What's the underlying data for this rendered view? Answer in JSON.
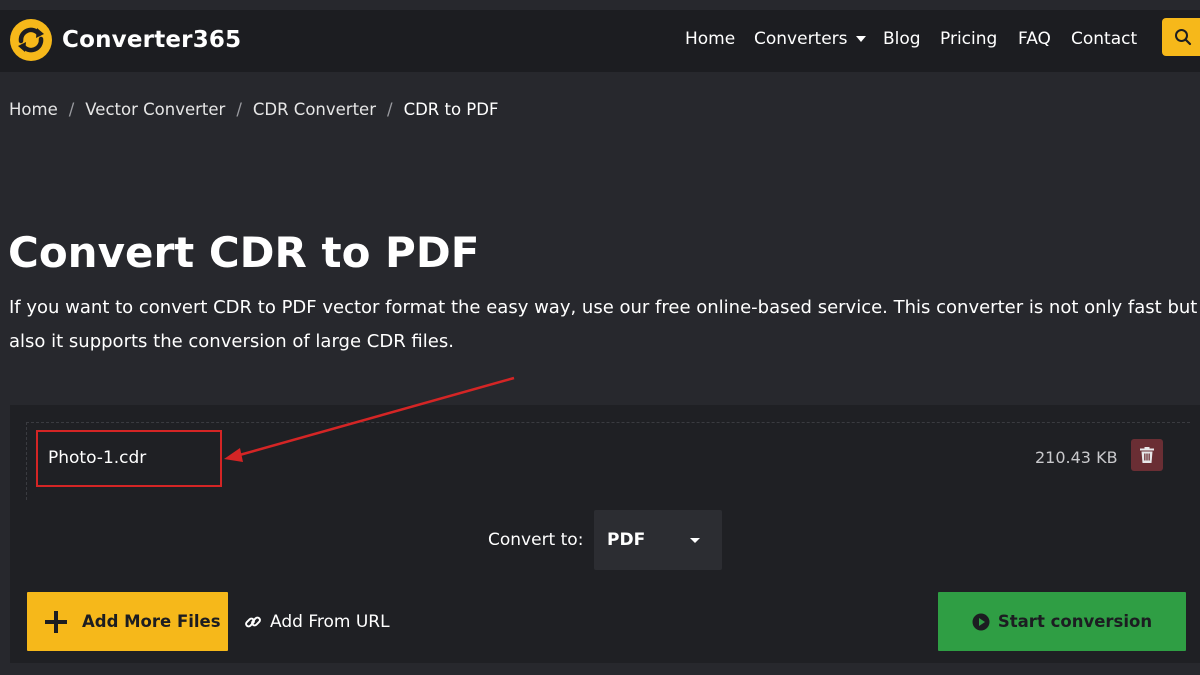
{
  "header": {
    "logo_text": "Converter365",
    "nav": {
      "home": "Home",
      "converters": "Converters",
      "blog": "Blog",
      "pricing": "Pricing",
      "faq": "FAQ",
      "contact": "Contact"
    }
  },
  "breadcrumb": [
    "Home",
    "Vector Converter",
    "CDR Converter",
    "CDR to PDF"
  ],
  "main": {
    "title": "Convert CDR to PDF",
    "description": "If you want to convert CDR to PDF vector format the easy way, use our free online-based service. This converter is not only fast but also it supports the conversion of large CDR files."
  },
  "converter": {
    "file_name": "Photo-1.cdr",
    "file_size": "210.43 KB",
    "convert_to_label": "Convert to:",
    "format_selected": "PDF",
    "add_files_label": "Add More Files",
    "add_url_label": "Add From URL",
    "start_label": "Start conversion"
  },
  "colors": {
    "accent_yellow": "#f6b81a",
    "start_green": "#2f9e44",
    "delete_red": "#6a2e34",
    "annotation_red": "#d42525"
  }
}
